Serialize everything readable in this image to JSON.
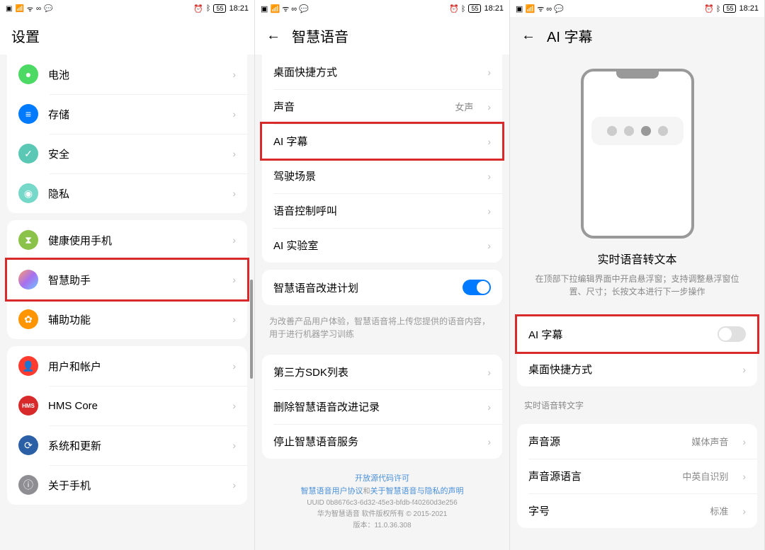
{
  "status": {
    "time": "18:21",
    "battery": "55"
  },
  "s1": {
    "title": "设置",
    "items1": [
      {
        "icon": "ic-green",
        "glyph": "●",
        "label": "电池"
      },
      {
        "icon": "ic-blue",
        "glyph": "≡",
        "label": "存储"
      },
      {
        "icon": "ic-teal",
        "glyph": "✓",
        "label": "安全"
      },
      {
        "icon": "ic-mint",
        "glyph": "◉",
        "label": "隐私"
      }
    ],
    "items2": [
      {
        "icon": "ic-lime",
        "glyph": "⧗",
        "label": "健康使用手机"
      },
      {
        "icon": "ic-grad",
        "glyph": "",
        "label": "智慧助手",
        "hl": true
      },
      {
        "icon": "ic-orange",
        "glyph": "✿",
        "label": "辅助功能"
      }
    ],
    "items3": [
      {
        "icon": "ic-red",
        "glyph": "👤",
        "label": "用户和帐户"
      },
      {
        "icon": "ic-hms",
        "glyph": "HMS",
        "label": "HMS Core"
      },
      {
        "icon": "ic-darkblue",
        "glyph": "⟳",
        "label": "系统和更新"
      },
      {
        "icon": "ic-grey",
        "glyph": "ⓘ",
        "label": "关于手机"
      }
    ]
  },
  "s2": {
    "title": "智慧语音",
    "g1": [
      {
        "label": "桌面快捷方式"
      },
      {
        "label": "声音",
        "value": "女声"
      },
      {
        "label": "AI 字幕",
        "hl": true
      },
      {
        "label": "驾驶场景"
      },
      {
        "label": "语音控制呼叫"
      },
      {
        "label": "AI 实验室"
      }
    ],
    "g2": {
      "label": "智慧语音改进计划",
      "hint": "为改善产品用户体验，智慧语音将上传您提供的语音内容，用于进行机器学习训练"
    },
    "g3": [
      {
        "label": "第三方SDK列表"
      },
      {
        "label": "删除智慧语音改进记录"
      },
      {
        "label": "停止智慧语音服务"
      }
    ],
    "footer": {
      "l1": "开放源代码许可",
      "l2a": "智慧语音用户协议",
      "l2b": "和",
      "l2c": "关于智慧语音与隐私的声明",
      "l3": "UUID 0b8676c3-6d32-45e3-bfdb-f40260d3e256",
      "l4": "华为智慧语音 软件版权所有 © 2015-2021",
      "l5": "版本：11.0.36.308"
    }
  },
  "s3": {
    "title": "AI 字幕",
    "illus_title": "实时语音转文本",
    "illus_desc": "在顶部下拉编辑界面中开启悬浮窗；支持调整悬浮窗位置、尺寸；长按文本进行下一步操作",
    "g1": [
      {
        "label": "AI 字幕",
        "toggle": "off",
        "hl": true
      },
      {
        "label": "桌面快捷方式",
        "chev": true
      }
    ],
    "sec_label": "实时语音转文字",
    "g2": [
      {
        "label": "声音源",
        "value": "媒体声音"
      },
      {
        "label": "声音源语言",
        "value": "中英自识别"
      },
      {
        "label": "字号",
        "value": "标准"
      }
    ]
  }
}
